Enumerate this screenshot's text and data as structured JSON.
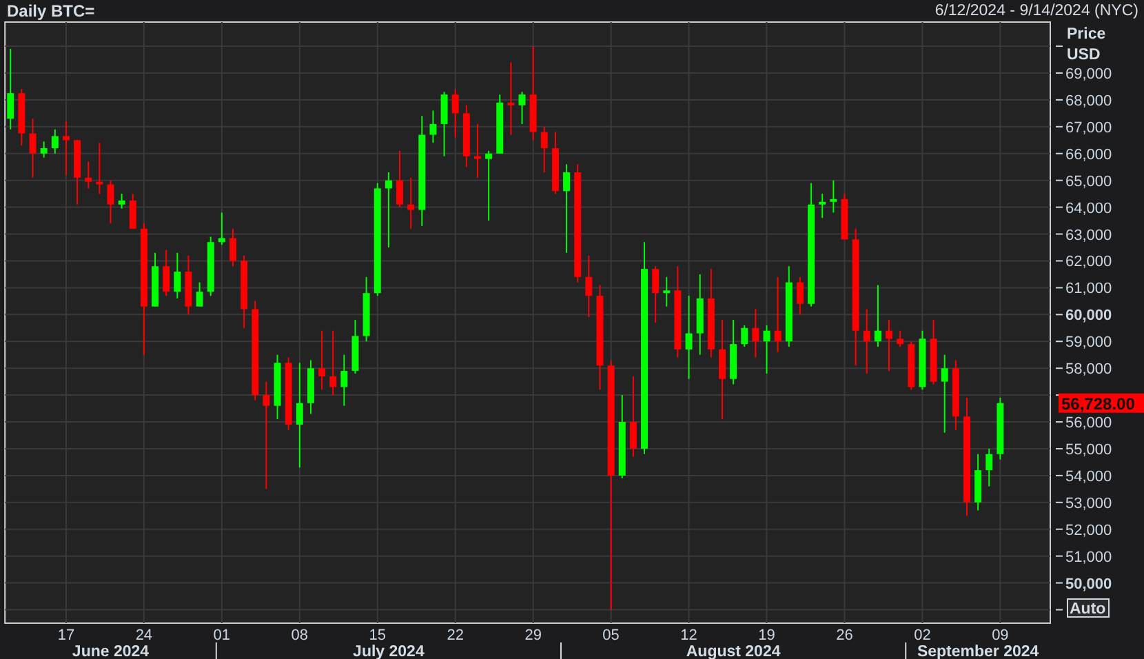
{
  "header": {
    "title": "Daily BTC=",
    "range": "6/12/2024 - 9/14/2024 (NYC)"
  },
  "price_axis": {
    "label": "Price",
    "unit": "USD",
    "last_price": "56,728.00",
    "auto_button": "Auto"
  },
  "months": [
    "June 2024",
    "July 2024",
    "August 2024",
    "September 2024"
  ],
  "chart_data": {
    "type": "candlestick",
    "categories": [
      null,
      null,
      null,
      null,
      null,
      "17",
      null,
      null,
      null,
      null,
      null,
      null,
      "24",
      null,
      null,
      null,
      null,
      null,
      null,
      "01",
      null,
      null,
      null,
      null,
      null,
      null,
      "08",
      null,
      null,
      null,
      null,
      null,
      null,
      "15",
      null,
      null,
      null,
      null,
      null,
      null,
      "22",
      null,
      null,
      null,
      null,
      null,
      null,
      "29",
      null,
      null,
      null,
      null,
      null,
      null,
      "05",
      null,
      null,
      null,
      null,
      null,
      null,
      "12",
      null,
      null,
      null,
      null,
      null,
      null,
      "19",
      null,
      null,
      null,
      null,
      null,
      null,
      "26",
      null,
      null,
      null,
      null,
      null,
      null,
      "02",
      null,
      null,
      null,
      null,
      null,
      null,
      "09"
    ],
    "ohlc": [
      [
        67300,
        69900,
        66900,
        68250
      ],
      [
        68250,
        68400,
        66300,
        66750
      ],
      [
        66750,
        67300,
        65100,
        66000
      ],
      [
        66000,
        66450,
        65850,
        66200
      ],
      [
        66200,
        66900,
        66000,
        66650
      ],
      [
        66650,
        67200,
        65200,
        66500
      ],
      [
        66500,
        66500,
        64100,
        65100
      ],
      [
        65100,
        65700,
        64700,
        64950
      ],
      [
        64950,
        66400,
        64500,
        64850
      ],
      [
        64850,
        65000,
        63400,
        64100
      ],
      [
        64100,
        64500,
        63950,
        64250
      ],
      [
        64250,
        64500,
        63200,
        63200
      ],
      [
        63200,
        63400,
        58500,
        60300
      ],
      [
        60300,
        62300,
        60300,
        61800
      ],
      [
        61800,
        62400,
        60700,
        60850
      ],
      [
        60850,
        62300,
        60600,
        61600
      ],
      [
        61600,
        62200,
        60000,
        60300
      ],
      [
        60300,
        61200,
        60300,
        60850
      ],
      [
        60850,
        62900,
        60700,
        62700
      ],
      [
        62700,
        63800,
        62600,
        62850
      ],
      [
        62850,
        63200,
        61800,
        62000
      ],
      [
        62000,
        62200,
        59500,
        60200
      ],
      [
        60200,
        60500,
        56800,
        57000
      ],
      [
        57000,
        57500,
        53500,
        56600
      ],
      [
        56600,
        58500,
        56100,
        58200
      ],
      [
        58200,
        58400,
        55700,
        55900
      ],
      [
        55900,
        58200,
        54300,
        56700
      ],
      [
        56700,
        58300,
        56300,
        58000
      ],
      [
        58000,
        59400,
        57200,
        57700
      ],
      [
        57700,
        59400,
        57000,
        57300
      ],
      [
        57300,
        58500,
        56600,
        57900
      ],
      [
        57900,
        59800,
        57800,
        59200
      ],
      [
        59200,
        61400,
        59000,
        60800
      ],
      [
        60800,
        64900,
        60700,
        64700
      ],
      [
        64700,
        65300,
        62500,
        65000
      ],
      [
        65000,
        66100,
        64000,
        64100
      ],
      [
        64100,
        65100,
        63200,
        63900
      ],
      [
        63900,
        67400,
        63300,
        66700
      ],
      [
        66700,
        67600,
        66400,
        67100
      ],
      [
        67100,
        68300,
        65900,
        68200
      ],
      [
        68200,
        68400,
        66600,
        67500
      ],
      [
        67500,
        67800,
        65500,
        65900
      ],
      [
        65900,
        67100,
        65100,
        65800
      ],
      [
        65800,
        66100,
        63500,
        66000
      ],
      [
        66000,
        68200,
        66000,
        67900
      ],
      [
        67900,
        69400,
        66700,
        67800
      ],
      [
        67800,
        68300,
        67100,
        68200
      ],
      [
        68200,
        70000,
        66500,
        66800
      ],
      [
        66800,
        67000,
        65300,
        66200
      ],
      [
        66200,
        66800,
        64500,
        64600
      ],
      [
        64600,
        65600,
        62300,
        65300
      ],
      [
        65300,
        65600,
        61200,
        61400
      ],
      [
        61400,
        62200,
        59900,
        60700
      ],
      [
        60700,
        61100,
        57200,
        58100
      ],
      [
        58100,
        58300,
        49000,
        54000
      ],
      [
        54000,
        57000,
        53900,
        56000
      ],
      [
        56000,
        57700,
        54700,
        55000
      ],
      [
        55000,
        62700,
        54800,
        61700
      ],
      [
        61700,
        61800,
        59700,
        60800
      ],
      [
        60800,
        61400,
        60300,
        60900
      ],
      [
        60900,
        61800,
        58400,
        58700
      ],
      [
        58700,
        60700,
        57600,
        59300
      ],
      [
        59300,
        61500,
        58500,
        60600
      ],
      [
        60600,
        61700,
        58400,
        58700
      ],
      [
        58700,
        59800,
        56100,
        57600
      ],
      [
        57600,
        59800,
        57400,
        58900
      ],
      [
        58900,
        59600,
        58800,
        59500
      ],
      [
        59500,
        60200,
        58400,
        59000
      ],
      [
        59000,
        59600,
        57800,
        59400
      ],
      [
        59400,
        61400,
        58600,
        59000
      ],
      [
        59000,
        61800,
        58800,
        61200
      ],
      [
        61200,
        61400,
        60000,
        60400
      ],
      [
        60400,
        64900,
        60300,
        64100
      ],
      [
        64100,
        64500,
        63600,
        64200
      ],
      [
        64200,
        65000,
        63800,
        64300
      ],
      [
        64300,
        64500,
        62800,
        62800
      ],
      [
        62800,
        63200,
        58100,
        59400
      ],
      [
        59400,
        60200,
        57800,
        59000
      ],
      [
        59000,
        61100,
        58800,
        59400
      ],
      [
        59400,
        59800,
        57900,
        59100
      ],
      [
        59100,
        59400,
        58800,
        58900
      ],
      [
        58900,
        59000,
        57200,
        57300
      ],
      [
        57300,
        59400,
        57200,
        59100
      ],
      [
        59100,
        59800,
        57400,
        57500
      ],
      [
        57500,
        58500,
        55600,
        58000
      ],
      [
        58000,
        58300,
        55700,
        56200
      ],
      [
        56200,
        56900,
        52500,
        53000
      ],
      [
        53000,
        54800,
        52700,
        54200
      ],
      [
        54200,
        55000,
        53600,
        54800
      ],
      [
        54800,
        56900,
        54600,
        56700
      ]
    ],
    "ylim": [
      48500,
      70900
    ],
    "grid": true,
    "yticks": [
      {
        "value": 69000,
        "label": "69,000"
      },
      {
        "value": 68000,
        "label": "68,000"
      },
      {
        "value": 67000,
        "label": "67,000"
      },
      {
        "value": 66000,
        "label": "66,000"
      },
      {
        "value": 65000,
        "label": "65,000"
      },
      {
        "value": 64000,
        "label": "64,000"
      },
      {
        "value": 63000,
        "label": "63,000"
      },
      {
        "value": 62000,
        "label": "62,000"
      },
      {
        "value": 61000,
        "label": "61,000"
      },
      {
        "value": 60000,
        "label": "60,000"
      },
      {
        "value": 59000,
        "label": "59,000"
      },
      {
        "value": 58000,
        "label": "58,000"
      },
      {
        "value": 56000,
        "label": "56,000"
      },
      {
        "value": 55000,
        "label": "55,000"
      },
      {
        "value": 54000,
        "label": "54,000"
      },
      {
        "value": 53000,
        "label": "53,000"
      },
      {
        "value": 52000,
        "label": "52,000"
      },
      {
        "value": 51000,
        "label": "51,000"
      },
      {
        "value": 50000,
        "label": "50,000"
      }
    ]
  }
}
